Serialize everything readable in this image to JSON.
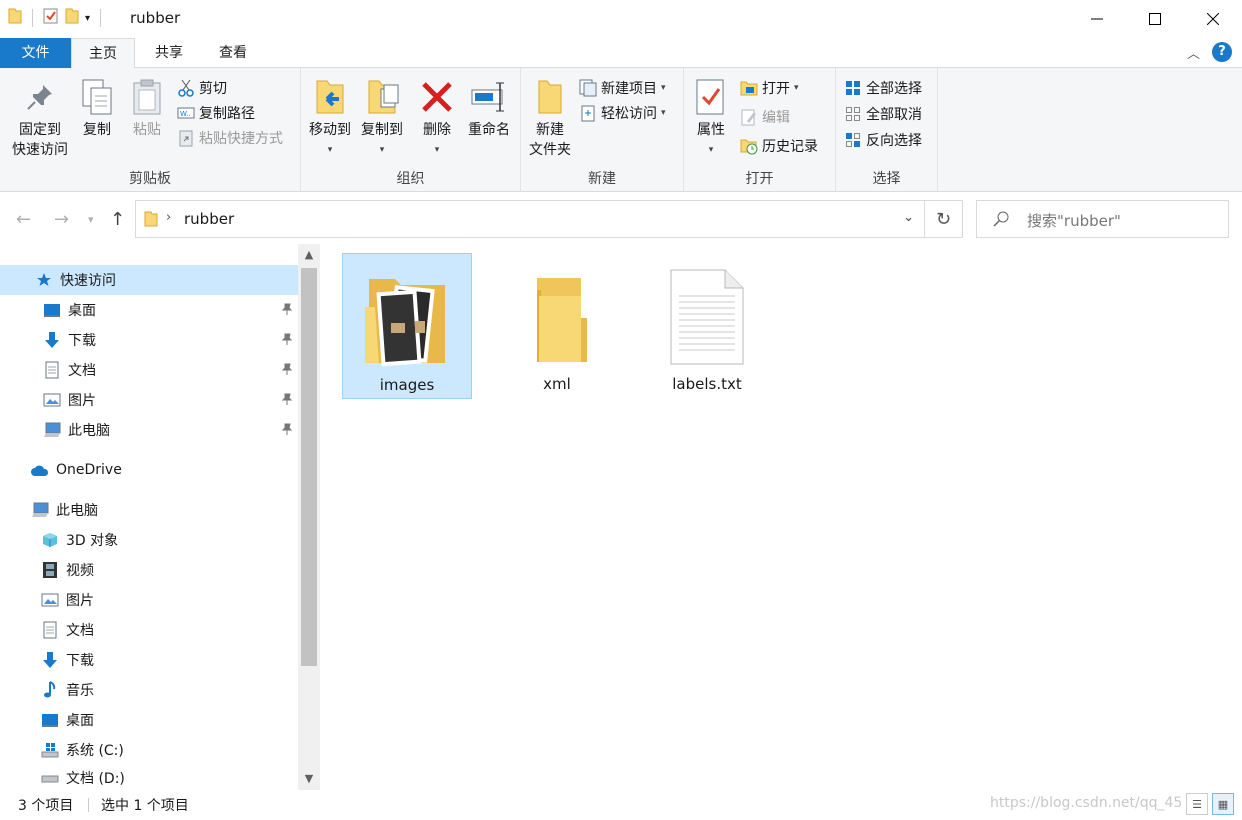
{
  "window": {
    "title": "rubber"
  },
  "tabs": {
    "file": "文件",
    "home": "主页",
    "share": "共享",
    "view": "查看"
  },
  "ribbon": {
    "clipboard": {
      "label": "剪贴板",
      "pin": "固定到\n快速访问",
      "copy": "复制",
      "paste": "粘贴",
      "cut": "剪切",
      "copy_path": "复制路径",
      "paste_shortcut": "粘贴快捷方式"
    },
    "organize": {
      "label": "组织",
      "move_to": "移动到",
      "copy_to": "复制到",
      "delete": "删除",
      "rename": "重命名"
    },
    "new": {
      "label": "新建",
      "new_folder": "新建\n文件夹",
      "new_item": "新建项目",
      "easy_access": "轻松访问"
    },
    "open": {
      "label": "打开",
      "properties": "属性",
      "open": "打开",
      "edit": "编辑",
      "history": "历史记录"
    },
    "select": {
      "label": "选择",
      "select_all": "全部选择",
      "select_none": "全部取消",
      "invert": "反向选择"
    }
  },
  "address": {
    "path": "rubber",
    "search_placeholder": "搜索\"rubber\""
  },
  "nav": {
    "quick_access": "快速访问",
    "qa_items": [
      "桌面",
      "下载",
      "文档",
      "图片",
      "此电脑"
    ],
    "onedrive": "OneDrive",
    "this_pc": "此电脑",
    "pc_items": [
      "3D 对象",
      "视频",
      "图片",
      "文档",
      "下载",
      "音乐",
      "桌面",
      "系统 (C:)",
      "文档 (D:)"
    ]
  },
  "files": [
    {
      "name": "images",
      "type": "folder-images",
      "selected": true
    },
    {
      "name": "xml",
      "type": "folder",
      "selected": false
    },
    {
      "name": "labels.txt",
      "type": "text",
      "selected": false
    }
  ],
  "status": {
    "count": "3 个项目",
    "selected": "选中 1 个项目",
    "watermark": "https://blog.csdn.net/qq_45"
  },
  "colors": {
    "accent": "#1979ca",
    "selection": "#cce8ff",
    "folder": "#f8d775"
  }
}
